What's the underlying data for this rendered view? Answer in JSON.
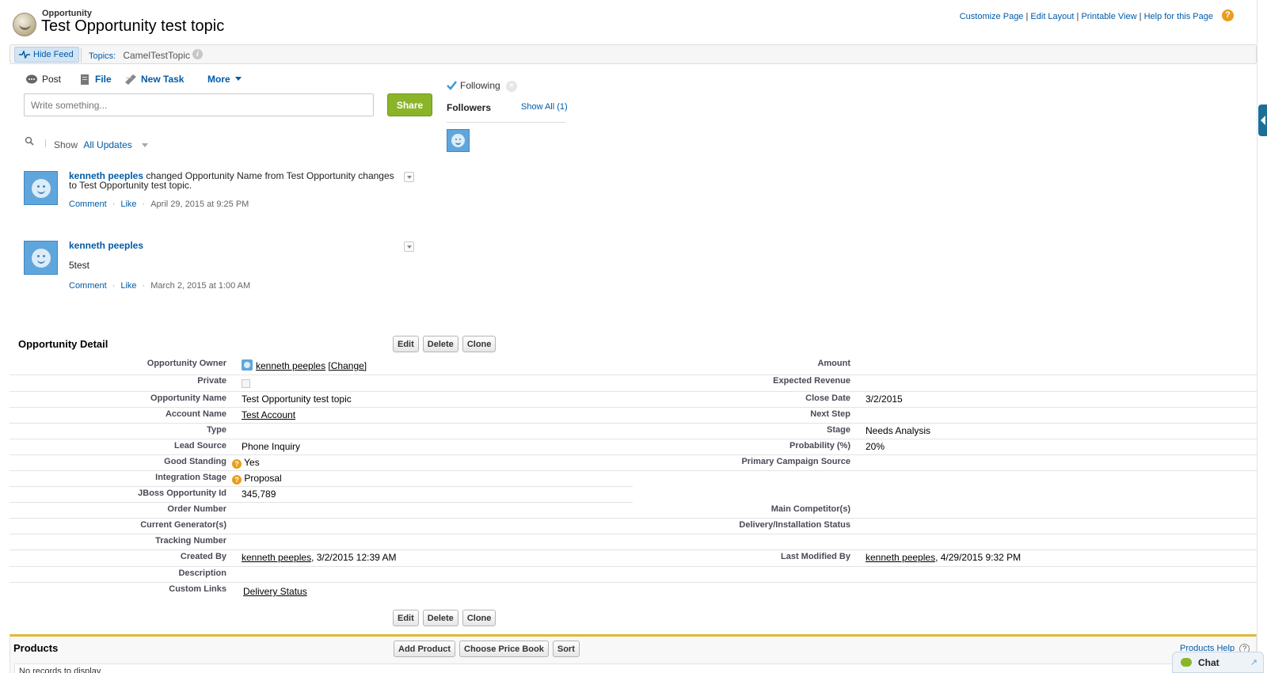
{
  "header": {
    "record_type": "Opportunity",
    "record_name": "Test Opportunity test topic",
    "links": [
      "Customize Page",
      "Edit Layout",
      "Printable View",
      "Help for this Page"
    ],
    "help_glyph": "?"
  },
  "feed_bar": {
    "hide_feed_label": "Hide Feed",
    "topics_label": "Topics:",
    "topic_value": "CamelTestTopic",
    "info_glyph": "i"
  },
  "publisher": {
    "tabs": [
      "Post",
      "File",
      "New Task",
      "More"
    ],
    "input_placeholder": "Write something...",
    "share_label": "Share",
    "show_label": "Show",
    "filter_value": "All Updates"
  },
  "feed": [
    {
      "actor": "kenneth peeples",
      "text": " changed Opportunity Name from Test Opportunity changes to Test Opportunity test topic.",
      "comment": "Comment",
      "like": "Like",
      "timestamp": "April 29, 2015 at 9:25 PM"
    },
    {
      "actor": "kenneth peeples",
      "body": "5test",
      "comment": "Comment",
      "like": "Like",
      "timestamp": "March 2, 2015 at 1:00 AM"
    }
  ],
  "followers": {
    "following_label": "Following",
    "unfollow_glyph": "×",
    "followers_label": "Followers",
    "show_all": "Show All (1)"
  },
  "detail": {
    "title": "Opportunity Detail",
    "buttons": [
      "Edit",
      "Delete",
      "Clone"
    ],
    "change_link": "[Change]",
    "left": [
      {
        "label": "Opportunity Owner",
        "value": "kenneth peeples"
      },
      {
        "label": "Private",
        "value": ""
      },
      {
        "label": "Opportunity Name",
        "value": "Test Opportunity test topic"
      },
      {
        "label": "Account Name",
        "value": "Test Account"
      },
      {
        "label": "Type",
        "value": ""
      },
      {
        "label": "Lead Source",
        "value": "Phone Inquiry"
      },
      {
        "label": "Good Standing",
        "value": "Yes"
      },
      {
        "label": "Integration Stage",
        "value": "Proposal"
      },
      {
        "label": "JBoss Opportunity Id",
        "value": "345,789"
      },
      {
        "label": "Order Number",
        "value": ""
      },
      {
        "label": "Current Generator(s)",
        "value": ""
      },
      {
        "label": "Tracking Number",
        "value": ""
      },
      {
        "label": "Created By",
        "value": "kenneth peeples",
        "suffix": ", 3/2/2015 12:39 AM"
      },
      {
        "label": "Description",
        "value": ""
      },
      {
        "label": "Custom Links",
        "value": "Delivery Status"
      }
    ],
    "right": [
      {
        "label": "Amount",
        "value": ""
      },
      {
        "label": "Expected Revenue",
        "value": ""
      },
      {
        "label": "Close Date",
        "value": "3/2/2015"
      },
      {
        "label": "Next Step",
        "value": ""
      },
      {
        "label": "Stage",
        "value": "Needs Analysis"
      },
      {
        "label": "Probability (%)",
        "value": "20%"
      },
      {
        "label": "Primary Campaign Source",
        "value": ""
      },
      {
        "label": "Main Competitor(s)",
        "value": ""
      },
      {
        "label": "Delivery/Installation Status",
        "value": ""
      },
      {
        "label": "Last Modified By",
        "value": "kenneth peeples",
        "suffix": ", 4/29/2015 9:32 PM"
      }
    ],
    "help_glyph": "?"
  },
  "products": {
    "title": "Products",
    "buttons": [
      "Add Product",
      "Choose Price Book",
      "Sort"
    ],
    "help_label": "Products Help",
    "help_glyph": "?",
    "empty_text": "No records to display"
  },
  "chat": {
    "label": "Chat",
    "arrow_glyph": "↗"
  },
  "colors": {
    "link": "#015ba7",
    "share_green": "#8ab529",
    "products_accent": "#e0b930",
    "avatar_blue": "#5fa6dc"
  }
}
